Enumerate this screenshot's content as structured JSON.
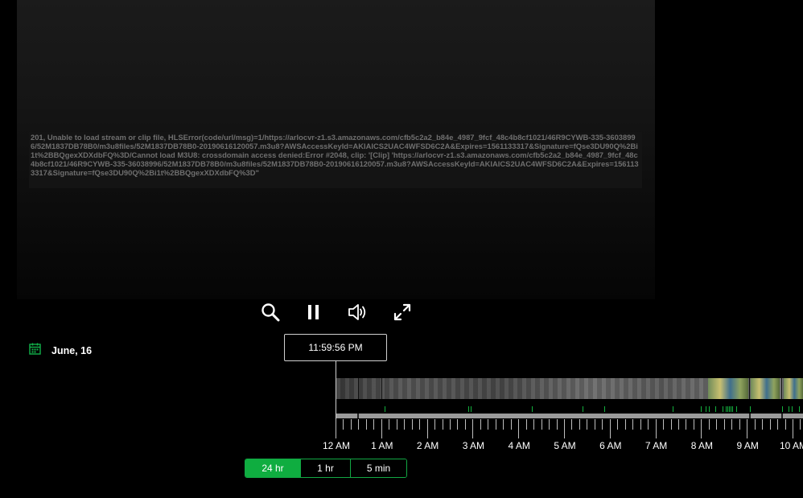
{
  "error_message": "201, Unable to load stream or clip file, HLSError(code/url/msg)=1/https://arlocvr-z1.s3.amazonaws.com/cfb5c2a2_b84e_4987_9fcf_48c4b8cf1021/46R9CYWB-335-36038996/52M1837DB78B0/m3u8files/52M1837DB78B0-20190616120057.m3u8?AWSAccessKeyId=AKIAICS2UAC4WFSD6C2A&Expires=1561133317&Signature=fQse3DU90Q%2Bi1t%2BBQgexXDXdbFQ%3D/Cannot load M3U8: crossdomain access denied:Error #2048, clip: '[Clip] 'https://arlocvr-z1.s3.amazonaws.com/cfb5c2a2_b84e_4987_9fcf_48c4b8cf1021/46R9CYWB-335-36038996/52M1837DB78B0/m3u8files/52M1837DB78B0-20190616120057.m3u8?AWSAccessKeyId=AKIAICS2UAC4WFSD6C2A&Expires=1561133317&Signature=fQse3DU90Q%2Bi1t%2BBQgexXDXdbFQ%3D\"",
  "controls": {
    "search_icon": "search-icon",
    "pause_icon": "pause-icon",
    "volume_icon": "volume-icon",
    "fullscreen_icon": "fullscreen-icon"
  },
  "date": {
    "icon": "calendar-icon",
    "label": "June, 16"
  },
  "current_time": "11:59:56 PM",
  "timeline": {
    "hour_labels": [
      "12 AM",
      "1 AM",
      "2 AM",
      "3 AM",
      "4 AM",
      "5 AM",
      "6 AM",
      "7 AM",
      "8 AM",
      "9 AM",
      "10 AM"
    ]
  },
  "range_buttons": [
    {
      "label": "24 hr",
      "active": true
    },
    {
      "label": "1 hr",
      "active": false
    },
    {
      "label": "5 min",
      "active": false
    }
  ],
  "colors": {
    "accent_green": "#0fad40",
    "event_green": "#13b13e"
  }
}
